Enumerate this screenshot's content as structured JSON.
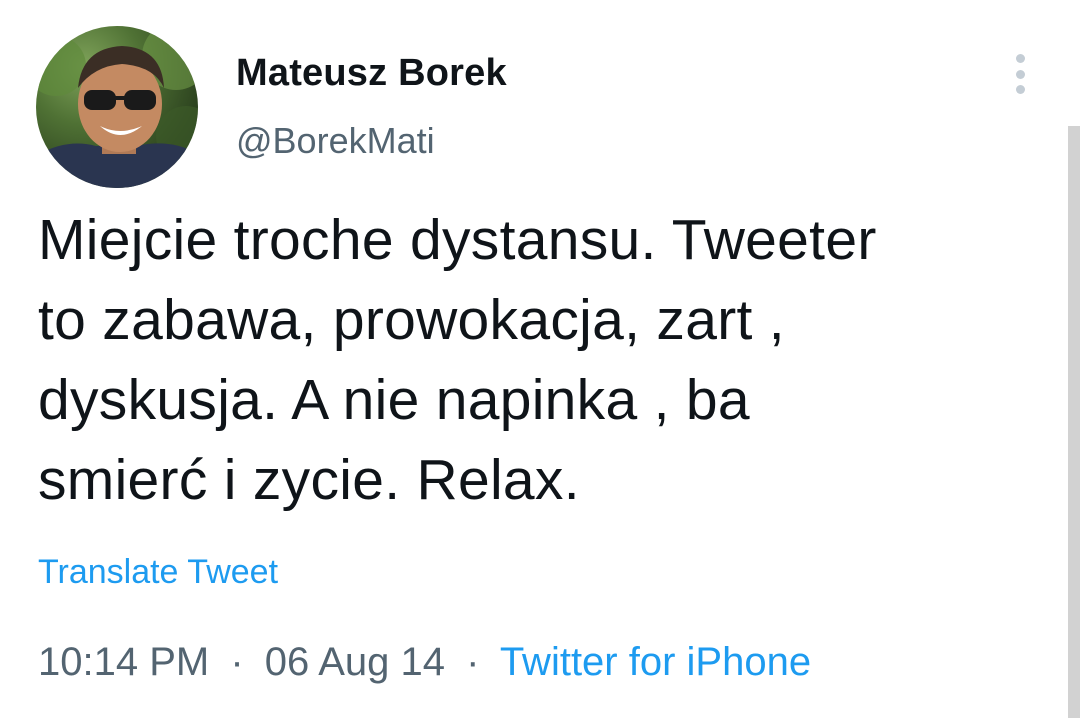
{
  "author": {
    "display_name": "Mateusz Borek",
    "handle": "@BorekMati",
    "avatar_icon": "profile-photo"
  },
  "tweet": {
    "text": "Miejcie troche dystansu. Tweeter\nto zabawa, prowokacja, zart ,\ndyskusja. A nie napinka , ba\nsmierć i zycie. Relax.",
    "translate_label": "Translate Tweet",
    "time": "10:14 PM",
    "date": "06 Aug 14",
    "separator": "·",
    "source": "Twitter for iPhone"
  },
  "icons": {
    "more": "more-options-icon"
  },
  "colors": {
    "link": "#1d9bf0",
    "secondary_text": "#536471",
    "primary_text": "#0f1419"
  }
}
